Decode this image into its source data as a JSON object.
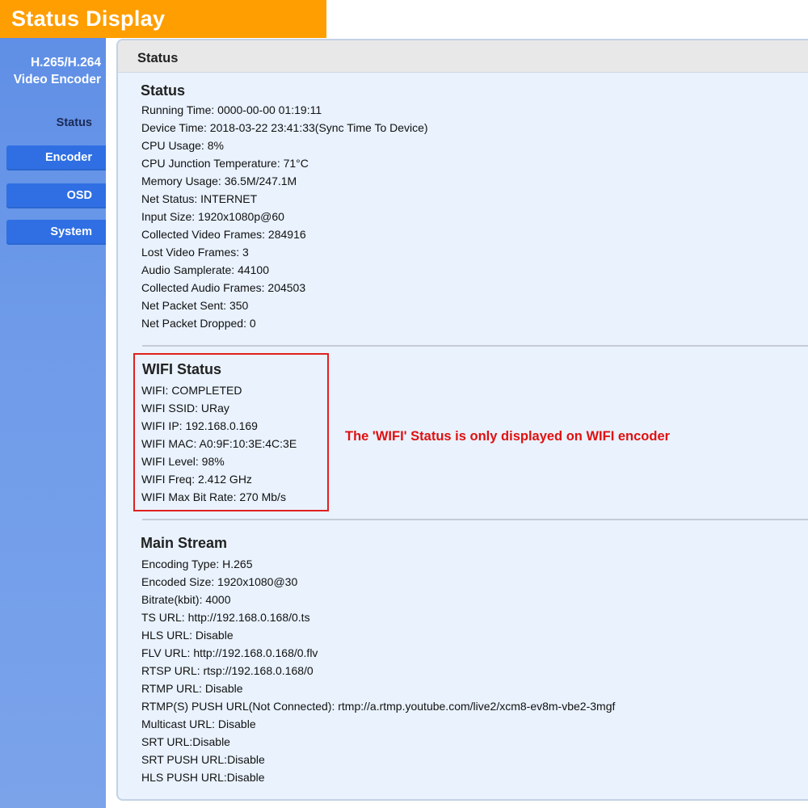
{
  "banner": {
    "title": "Status Display"
  },
  "sidebar": {
    "title_line1": "H.265/H.264",
    "title_line2": "Video Encoder",
    "items": [
      {
        "label": "Status"
      },
      {
        "label": "Encoder"
      },
      {
        "label": "OSD"
      },
      {
        "label": "System"
      }
    ]
  },
  "panel": {
    "header": "Status"
  },
  "status": {
    "title": "Status",
    "lines": [
      "Running Time: 0000-00-00 01:19:11",
      "Device Time: 2018-03-22 23:41:33(Sync Time To Device)",
      "CPU Usage: 8%",
      "CPU Junction Temperature: 71°C",
      "Memory Usage: 36.5M/247.1M",
      "Net Status: INTERNET",
      "Input Size: 1920x1080p@60",
      "Collected Video Frames: 284916",
      "Lost Video Frames: 3",
      "Audio Samplerate: 44100",
      "Collected Audio Frames: 204503",
      "Net Packet Sent: 350",
      "Net Packet Dropped: 0"
    ]
  },
  "wifi": {
    "title": "WIFI Status",
    "lines": [
      "WIFI: COMPLETED",
      "WIFI SSID: URay",
      "WIFI IP: 192.168.0.169",
      "WIFI MAC: A0:9F:10:3E:4C:3E",
      "WIFI Level: 98%",
      "WIFI Freq: 2.412 GHz",
      "WIFI Max Bit Rate: 270 Mb/s"
    ],
    "note": "The 'WIFI' Status is only displayed on WIFI encoder"
  },
  "main_stream": {
    "title": "Main Stream",
    "lines": [
      "Encoding Type: H.265",
      "Encoded Size: 1920x1080@30",
      "Bitrate(kbit): 4000",
      "TS URL: http://192.168.0.168/0.ts",
      "HLS URL: Disable",
      "FLV URL: http://192.168.0.168/0.flv",
      "RTSP URL: rtsp://192.168.0.168/0",
      "RTMP URL: Disable",
      "RTMP(S) PUSH URL(Not Connected): rtmp://a.rtmp.youtube.com/live2/xcm8-ev8m-vbe2-3mgf",
      "Multicast URL: Disable",
      "SRT URL:Disable",
      "SRT PUSH URL:Disable",
      "HLS PUSH URL:Disable"
    ]
  },
  "colors": {
    "banner": "#ff9e00",
    "sidebar": "#6f9be9",
    "nav_button": "#2f6fe3",
    "panel_bg": "#e9f2fd",
    "highlight_red": "#e02020"
  }
}
